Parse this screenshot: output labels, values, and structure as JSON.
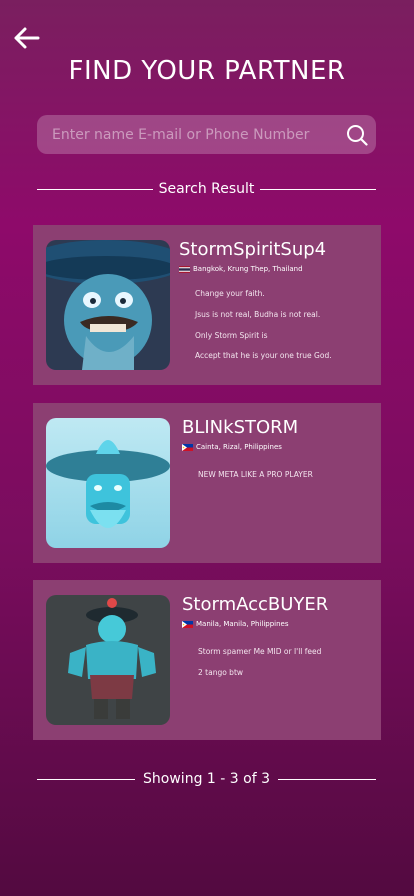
{
  "header": {
    "title": "FIND YOUR PARTNER"
  },
  "search": {
    "placeholder": "Enter name E-mail or Phone Number",
    "value": ""
  },
  "section_label": "Search Result",
  "results": [
    {
      "name": "StormSpiritSup4",
      "location": "Bangkok, Krung Thep, Thailand",
      "flag": "thailand-flag-icon",
      "bio": [
        "Change your faith.",
        "Jsus is not real, Budha is not real.",
        "Only Storm Spirit is",
        "Accept that he is your one true God."
      ]
    },
    {
      "name": "BLINkSTORM",
      "location": "Cainta, Rizal, Philippines",
      "flag": "philippines-flag-icon",
      "bio": [
        "NEW META LIKE A PRO PLAYER"
      ]
    },
    {
      "name": "StormAccBUYER",
      "location": "Manila, Manila, Philippines",
      "flag": "philippines-flag-icon",
      "bio": [
        "Storm spamer Me MID or I'll feed",
        "2 tango btw"
      ]
    }
  ],
  "footer": {
    "showing": "Showing 1 - 3 of 3"
  },
  "colors": {
    "card": "#8c3f72",
    "background_top": "#7a1f5f",
    "background_bottom": "#530a40"
  }
}
